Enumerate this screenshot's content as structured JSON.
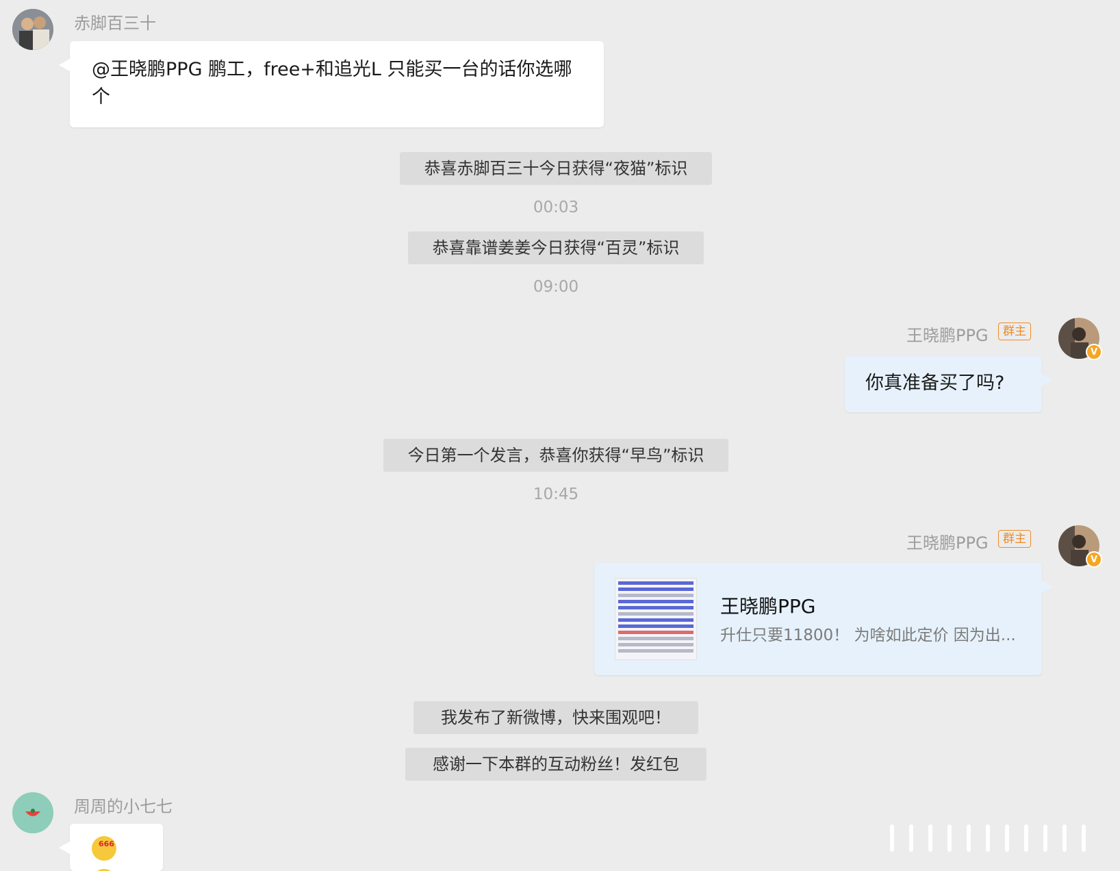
{
  "messages": {
    "m1": {
      "sender": "赤脚百三十",
      "text": "@王晓鹏PPG 鹏工，free+和追光L 只能买一台的话你选哪个"
    },
    "sys1": "恭喜赤脚百三十今日获得“夜猫”标识",
    "t1": "00:03",
    "sys2": "恭喜靠谱姜姜今日获得“百灵”标识",
    "t2": "09:00",
    "m2": {
      "sender": "王晓鹏PPG",
      "tag": "群主",
      "text": "你真准备买了吗?"
    },
    "sys3": "今日第一个发言，恭喜你获得“早鸟”标识",
    "t3": "10:45",
    "m3": {
      "sender": "王晓鹏PPG",
      "tag": "群主",
      "card_title": "王晓鹏PPG",
      "card_desc": "升仕只要11800！ 为啥如此定价 因为出..."
    },
    "sys4": "我发布了新微博，快来围观吧！",
    "sys5": "感谢一下本群的互动粉丝！发红包",
    "m4": {
      "sender": "周周的小七七",
      "emoji_label": "666"
    }
  },
  "icons": {
    "verified_badge": "v-badge-icon",
    "badge_text": "V"
  },
  "colors": {
    "background": "#ececec",
    "owner_tag": "#f08a24",
    "bubble_blue": "#e6f1fb",
    "system_bg": "#dcdcdc"
  }
}
